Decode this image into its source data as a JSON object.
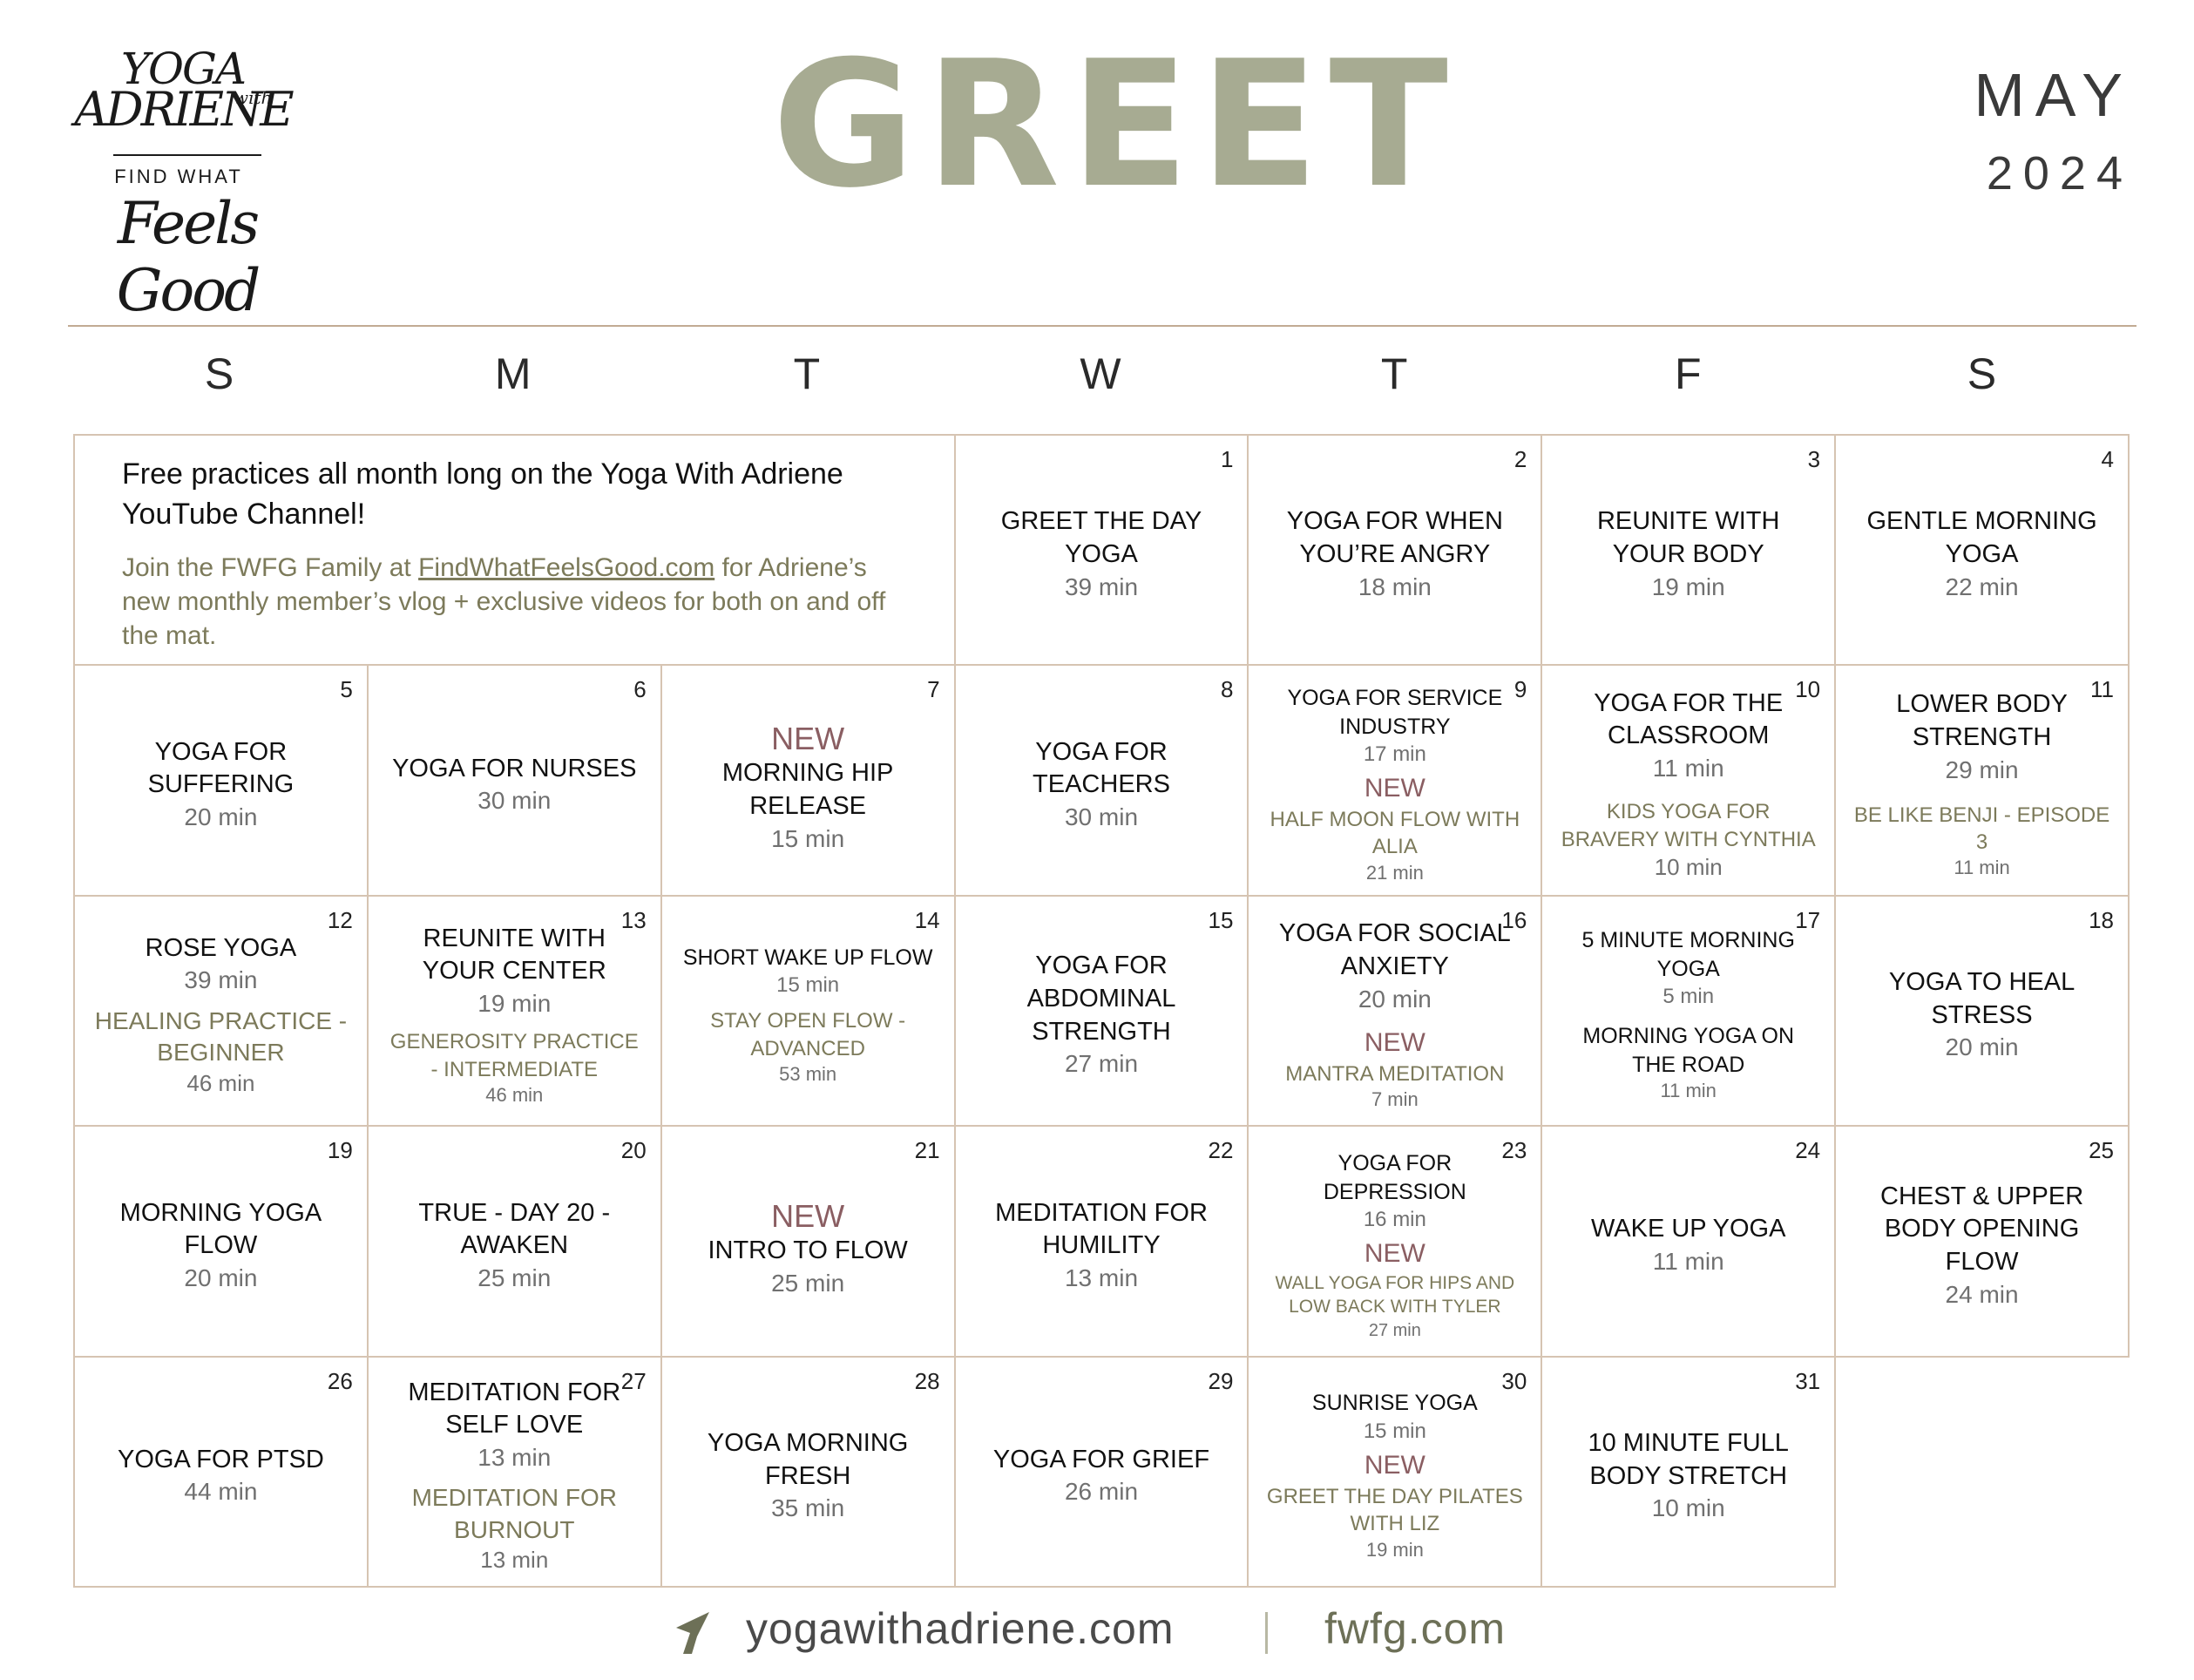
{
  "logo": {
    "line1": "YOGA",
    "with": "with",
    "line2": "ADRIENE",
    "tagline1": "FIND WHAT",
    "tagline2": "Feels Good"
  },
  "header": {
    "title": "GREET",
    "month": "MAY",
    "year": "2024"
  },
  "days_of_week": [
    "S",
    "M",
    "T",
    "W",
    "T",
    "F",
    "S"
  ],
  "intro": {
    "headline": "Free practices all month long on the Yoga With Adriene YouTube Channel!",
    "body_prefix": "Join the FWFG Family at ",
    "link": "FindWhatFeelsGood.com",
    "body_suffix": " for Adriene’s new monthly member’s vlog + exclusive videos for both on and off the mat."
  },
  "calendar": {
    "d1": {
      "num": "1",
      "title": "GREET THE DAY YOGA",
      "min": "39 min"
    },
    "d2": {
      "num": "2",
      "title": "YOGA FOR WHEN YOU’RE ANGRY",
      "min": "18 min"
    },
    "d3": {
      "num": "3",
      "title": "REUNITE WITH YOUR BODY",
      "min": "19 min"
    },
    "d4": {
      "num": "4",
      "title": "GENTLE MORNING YOGA",
      "min": "22 min"
    },
    "d5": {
      "num": "5",
      "title": "YOGA FOR SUFFERING",
      "min": "20 min"
    },
    "d6": {
      "num": "6",
      "title": "YOGA FOR NURSES",
      "min": "30 min"
    },
    "d7": {
      "num": "7",
      "new": "NEW",
      "title": "MORNING HIP RELEASE",
      "min": "15 min"
    },
    "d8": {
      "num": "8",
      "title": "YOGA FOR TEACHERS",
      "min": "30 min"
    },
    "d9": {
      "num": "9",
      "title": "YOGA FOR SERVICE INDUSTRY",
      "min": "17 min",
      "new": "NEW",
      "extra": "HALF MOON FLOW WITH ALIA",
      "extra_min": "21 min"
    },
    "d10": {
      "num": "10",
      "title": "YOGA FOR THE CLASSROOM",
      "min": "11 min",
      "extra": "KIDS YOGA FOR BRAVERY WITH CYNTHIA",
      "extra_min": "10 min"
    },
    "d11": {
      "num": "11",
      "title": "LOWER BODY STRENGTH",
      "min": "29 min",
      "extra": "BE LIKE BENJI - EPISODE 3",
      "extra_min": "11 min"
    },
    "d12": {
      "num": "12",
      "title": "ROSE YOGA",
      "min": "39 min",
      "extra": "HEALING PRACTICE - BEGINNER",
      "extra_min": "46 min"
    },
    "d13": {
      "num": "13",
      "title": "REUNITE WITH YOUR CENTER",
      "min": "19 min",
      "extra": "GENEROSITY PRACTICE - INTERMEDIATE",
      "extra_min": "46 min"
    },
    "d14": {
      "num": "14",
      "title": "SHORT WAKE UP FLOW",
      "min": "15 min",
      "extra": "STAY OPEN FLOW - ADVANCED",
      "extra_min": "53 min"
    },
    "d15": {
      "num": "15",
      "title": "YOGA FOR ABDOMINAL STRENGTH",
      "min": "27 min"
    },
    "d16": {
      "num": "16",
      "title": "YOGA FOR SOCIAL ANXIETY",
      "min": "20 min",
      "new": "NEW",
      "extra": "MANTRA MEDITATION",
      "extra_min": "7 min"
    },
    "d17": {
      "num": "17",
      "title": "5 MINUTE MORNING YOGA",
      "min": "5 min",
      "extra": "MORNING YOGA ON THE ROAD",
      "extra_min": "11 min"
    },
    "d18": {
      "num": "18",
      "title": "YOGA TO HEAL STRESS",
      "min": "20 min"
    },
    "d19": {
      "num": "19",
      "title": "MORNING YOGA FLOW",
      "min": "20 min"
    },
    "d20": {
      "num": "20",
      "title": "TRUE - DAY 20 - AWAKEN",
      "min": "25 min"
    },
    "d21": {
      "num": "21",
      "new": "NEW",
      "title": "INTRO TO FLOW",
      "min": "25 min"
    },
    "d22": {
      "num": "22",
      "title": "MEDITATION FOR HUMILITY",
      "min": "13 min"
    },
    "d23": {
      "num": "23",
      "title": "YOGA FOR DEPRESSION",
      "min": "16 min",
      "new": "NEW",
      "extra": "WALL YOGA FOR HIPS AND LOW BACK WITH TYLER",
      "extra_min": "27 min"
    },
    "d24": {
      "num": "24",
      "title": "WAKE UP YOGA",
      "min": "11 min"
    },
    "d25": {
      "num": "25",
      "title": "CHEST & UPPER BODY OPENING FLOW",
      "min": "24 min"
    },
    "d26": {
      "num": "26",
      "title": "YOGA FOR PTSD",
      "min": "44 min"
    },
    "d27": {
      "num": "27",
      "title": "MEDITATION FOR SELF LOVE",
      "min": "13 min",
      "extra": "MEDITATION FOR BURNOUT",
      "extra_min": "13 min"
    },
    "d28": {
      "num": "28",
      "title": "YOGA MORNING FRESH",
      "min": "35 min"
    },
    "d29": {
      "num": "29",
      "title": "YOGA FOR GRIEF",
      "min": "26 min"
    },
    "d30": {
      "num": "30",
      "title": "SUNRISE YOGA",
      "min": "15 min",
      "new": "NEW",
      "extra": "GREET THE DAY PILATES WITH LIZ",
      "extra_min": "19 min"
    },
    "d31": {
      "num": "31",
      "title": "10 MINUTE FULL BODY STRETCH",
      "min": "10 min"
    }
  },
  "footer": {
    "url1": "yogawithadriene.com",
    "url2": "fwfg.com",
    "icon": "arrow-icon"
  },
  "colors": {
    "title": "#a7ab92",
    "new": "#8a5e62",
    "secondary": "#7c7a5a",
    "border": "#d6c4b2"
  }
}
